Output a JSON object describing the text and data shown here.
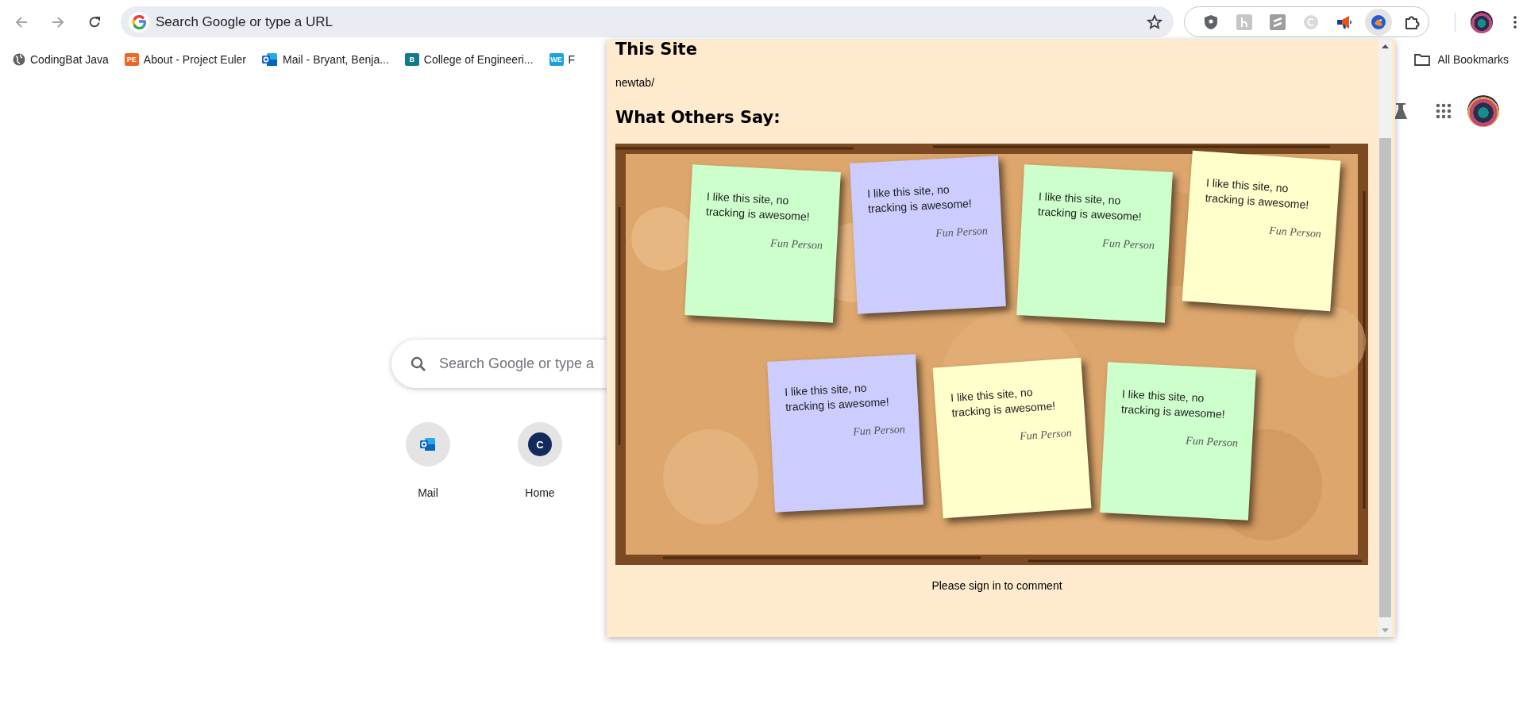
{
  "toolbar": {
    "address_placeholder": "Search Google or type a URL"
  },
  "bookmarks": [
    {
      "label": "CodingBat Java",
      "kind": "globe"
    },
    {
      "label": "About - Project Euler",
      "kind": "badge",
      "icon_text": "PE",
      "color": "#f26522"
    },
    {
      "label": "Mail - Bryant, Benja...",
      "kind": "outlook"
    },
    {
      "label": "College of Engineeri...",
      "kind": "badge",
      "icon_text": "B",
      "color": "#0f7b8a"
    },
    {
      "label": "F",
      "kind": "badge",
      "icon_text": "WE",
      "color": "#1ba1e2"
    }
  ],
  "all_bookmarks": "All Bookmarks",
  "new_tab": {
    "search_placeholder": "Search Google or type a",
    "shortcuts": [
      {
        "label": "Mail",
        "kind": "outlook"
      },
      {
        "label": "Home",
        "kind": "letter",
        "icon_text": "C"
      }
    ]
  },
  "popup": {
    "site_heading": "This Site",
    "site_path": "newtab/",
    "others_heading": "What Others Say:",
    "notes": [
      {
        "text": "I like this site, no tracking is awesome!",
        "author": "Fun Person",
        "color": "#ccffcc"
      },
      {
        "text": "I like this site, no tracking is awesome!",
        "author": "Fun Person",
        "color": "#ccccff"
      },
      {
        "text": "I like this site, no tracking is awesome!",
        "author": "Fun Person",
        "color": "#ccffcc"
      },
      {
        "text": "I like this site, no tracking is awesome!",
        "author": "Fun Person",
        "color": "#ffffcc"
      },
      {
        "text": "I like this site, no tracking is awesome!",
        "author": "Fun Person",
        "color": "#ccccff"
      },
      {
        "text": "I like this site, no tracking is awesome!",
        "author": "Fun Person",
        "color": "#ffffcc"
      },
      {
        "text": "I like this site, no tracking is awesome!",
        "author": "Fun Person",
        "color": "#ccffcc"
      }
    ],
    "footer": "Please sign in to comment"
  }
}
